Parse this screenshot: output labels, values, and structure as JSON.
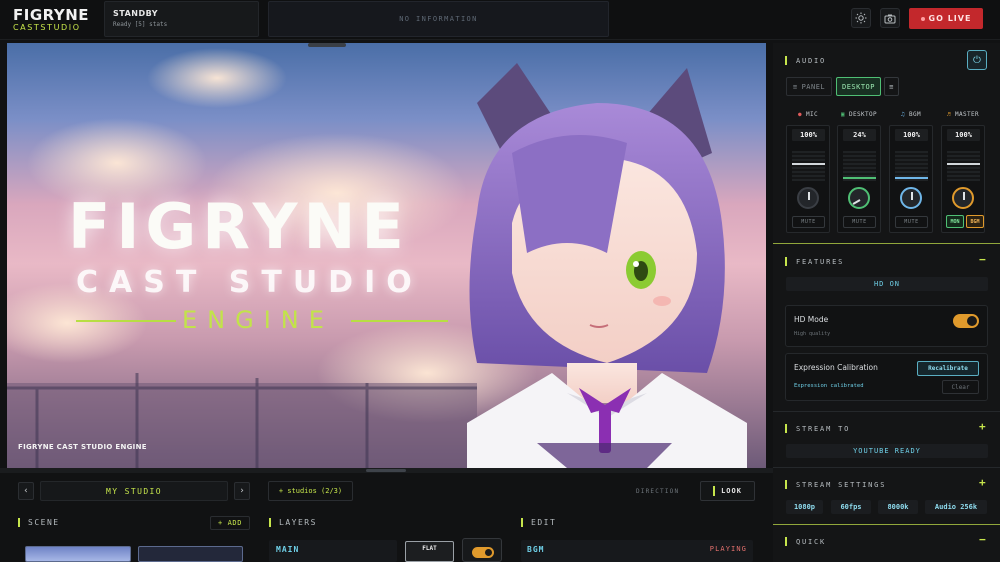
{
  "brand": {
    "name": "FIGRYNE",
    "sub": "CASTSTUDIO"
  },
  "status": {
    "title": "STANDBY",
    "subtitle": "Ready [5] stats"
  },
  "info_panel": {
    "text": "NO INFORMATION"
  },
  "toolbar": {
    "brightness_icon": "sun-icon",
    "camera_icon": "camera-icon",
    "go_live_label": "GO LIVE"
  },
  "stage": {
    "title_main": "FIGRYNE",
    "title_sub": "CAST STUDIO",
    "title_engine": "ENGINE",
    "caption": "FIGRYNE CAST STUDIO ENGINE"
  },
  "studio_nav": {
    "prev_icon": "chevron-left-icon",
    "name": "MY STUDIO",
    "next_icon": "chevron-right-icon",
    "studios_count": "+ studios (2/3)",
    "direction_label": "DIRECTION",
    "look_label": "LOOK"
  },
  "scene": {
    "heading": "SCENE",
    "add_label": "+ ADD"
  },
  "layers": {
    "heading": "LAYERS",
    "main_label": "MAIN",
    "flat_label": "FLAT",
    "toggle_on": true
  },
  "edit": {
    "heading": "EDIT",
    "track": "BGM",
    "state": "PLAYING"
  },
  "audio": {
    "heading": "AUDIO",
    "tabs": [
      {
        "label": "PANEL",
        "active": false
      },
      {
        "label": "DESKTOP",
        "active": true
      }
    ],
    "channels": [
      {
        "name": "MIC",
        "value": "100%",
        "level": 1.0,
        "mute": "MUTE"
      },
      {
        "name": "DESKTOP",
        "value": "24%",
        "level": 0.24,
        "mute": "MUTE"
      },
      {
        "name": "BGM",
        "value": "100%",
        "level": 1.0,
        "mute": "MUTE"
      },
      {
        "name": "MASTER",
        "value": "100%",
        "level": 1.0,
        "mon": "MON",
        "bgm": "BGM"
      }
    ]
  },
  "features": {
    "heading": "FEATURES",
    "hd_status": "HD ON",
    "hd_mode_title": "HD Mode",
    "hd_mode_sub": "High quality",
    "hd_mode_on": true,
    "exp_title": "Expression Calibration",
    "exp_sub": "Expression calibrated",
    "recalibrate_label": "Recalibrate",
    "clear_label": "Clear"
  },
  "stream_to": {
    "heading": "STREAM TO",
    "target": "YOUTUBE READY"
  },
  "stream_settings": {
    "heading": "STREAM SETTINGS",
    "resolution": "1080p",
    "fps": "60fps",
    "bitrate": "8000k",
    "audio": "Audio 256k"
  },
  "quick": {
    "heading": "QUICK"
  },
  "colors": {
    "accent": "#c6e54c",
    "live": "#c3282c",
    "cyan": "#6fd0e8",
    "toggle": "#e09a2c"
  }
}
